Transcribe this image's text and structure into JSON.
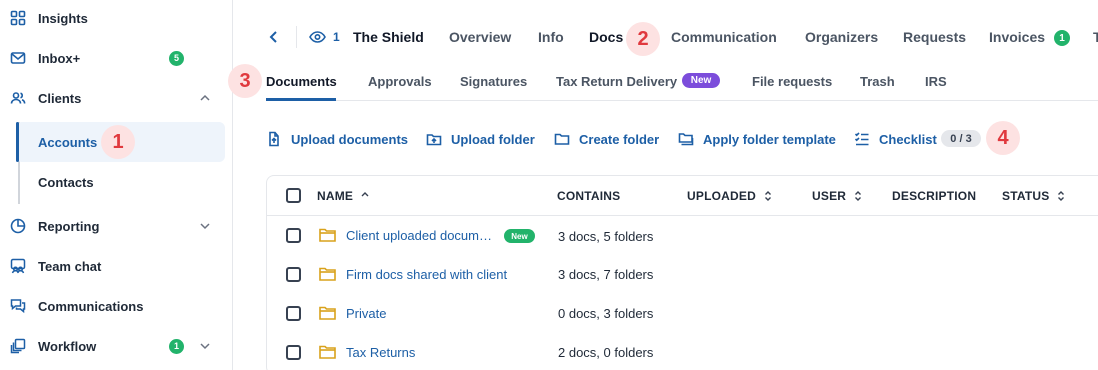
{
  "sidebar": {
    "items": [
      {
        "label": "Insights",
        "icon": "grid-icon"
      },
      {
        "label": "Inbox+",
        "icon": "mail-icon",
        "badge": "5"
      },
      {
        "label": "Clients",
        "icon": "users-icon"
      },
      {
        "label": "Reporting",
        "icon": "pie-chart-icon"
      },
      {
        "label": "Team chat",
        "icon": "team-chat-icon"
      },
      {
        "label": "Communications",
        "icon": "chat-icon"
      },
      {
        "label": "Workflow",
        "icon": "workflow-icon",
        "badge": "1"
      }
    ],
    "clients_sub": [
      "Accounts",
      "Contacts"
    ]
  },
  "markers": [
    "1",
    "2",
    "3",
    "4"
  ],
  "header": {
    "viewer_count": "1",
    "client_name": "The Shield",
    "tabs": [
      "Overview",
      "Info",
      "Docs",
      "Communication",
      "Organizers",
      "Requests",
      "Invoices"
    ],
    "invoices_badge": "1",
    "cut_tab": "T"
  },
  "subtabs": {
    "items": [
      "Documents",
      "Approvals",
      "Signatures",
      "Tax Return Delivery",
      "File requests",
      "Trash",
      "IRS"
    ],
    "new_label": "New"
  },
  "actions": {
    "upload_documents": "Upload documents",
    "upload_folder": "Upload folder",
    "create_folder": "Create folder",
    "apply_folder_template": "Apply folder template",
    "checklist": "Checklist",
    "checklist_count": "0 / 3"
  },
  "table": {
    "columns": [
      "NAME",
      "CONTAINS",
      "UPLOADED",
      "USER",
      "DESCRIPTION",
      "STATUS"
    ],
    "rows": [
      {
        "name": "Client uploaded docum…",
        "badge": "New",
        "contains": "3 docs, 5 folders"
      },
      {
        "name": "Firm docs shared with client",
        "contains": "3 docs, 7 folders"
      },
      {
        "name": "Private",
        "contains": "0 docs, 3 folders"
      },
      {
        "name": "Tax Returns",
        "contains": "2 docs, 0 folders"
      }
    ]
  },
  "colors": {
    "accent": "#1d5fa6",
    "badge_green": "#22b36b",
    "new_purple": "#7c4ddb",
    "marker_red": "#e0393e",
    "folder_yellow": "#d9a21b"
  }
}
